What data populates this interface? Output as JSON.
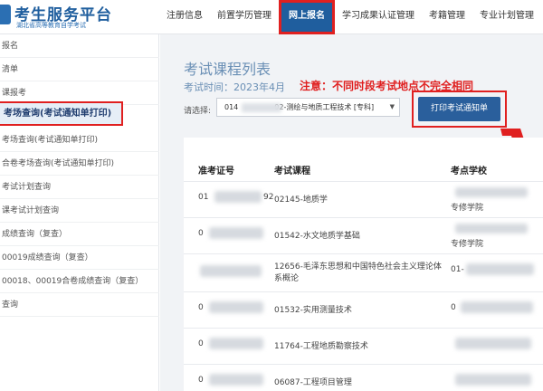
{
  "header": {
    "logo_title": "考生服务平台",
    "logo_subtitle": "湖北省高等教育自学考试",
    "nav": [
      "注册信息",
      "前置学历管理",
      "网上报名",
      "学习成果认证管理",
      "考籍管理",
      "专业计划管理"
    ],
    "active_nav_index": 2
  },
  "sidebar": {
    "items": [
      "报名",
      "清单",
      "课报考",
      "考场查询(考试通知单打印)",
      "考场查询(考试通知单打印)",
      "合卷考场查询(考试通知单打印)",
      "考试计划查询",
      "课考试计划查询",
      "成绩查询（复查）",
      "00019成绩查询（复查）",
      "00018、00019合卷成绩查询（复查）",
      "查询"
    ],
    "active_index": 3
  },
  "main": {
    "title": "考试课程列表",
    "exam_time": "考试时间：2023年4月",
    "notice": "注意：不同时段考试地点不完全相同",
    "select_label": "请选择:",
    "select_value": "014　　　　　02-测绘与地质工程技术 [专科]",
    "print_button": "打印考试通知单"
  },
  "table": {
    "headers": [
      "准考证号",
      "考试课程",
      "考点学校"
    ],
    "rows": [
      {
        "id_prefix": "01",
        "id_suffix": "92",
        "course": "02145-地质学",
        "school": "专修学院"
      },
      {
        "id_prefix": "0",
        "id_suffix": "",
        "course": "01542-水文地质学基础",
        "school": "专修学院"
      },
      {
        "id_prefix": "",
        "id_suffix": "",
        "course": "12656-毛泽东思想和中国特色社会主义理论体系概论",
        "school": "01-"
      },
      {
        "id_prefix": "0",
        "id_suffix": "",
        "course": "01532-实用测量技术",
        "school": "0"
      },
      {
        "id_prefix": "0",
        "id_suffix": "",
        "course": "11764-工程地质勘察技术",
        "school": ""
      },
      {
        "id_prefix": "0",
        "id_suffix": "",
        "course": "06087-工程项目管理",
        "school": ""
      }
    ]
  },
  "colors": {
    "brand_blue": "#1f5e9e",
    "annotation_red": "#e02020",
    "title_blue": "#6a8fb5"
  }
}
